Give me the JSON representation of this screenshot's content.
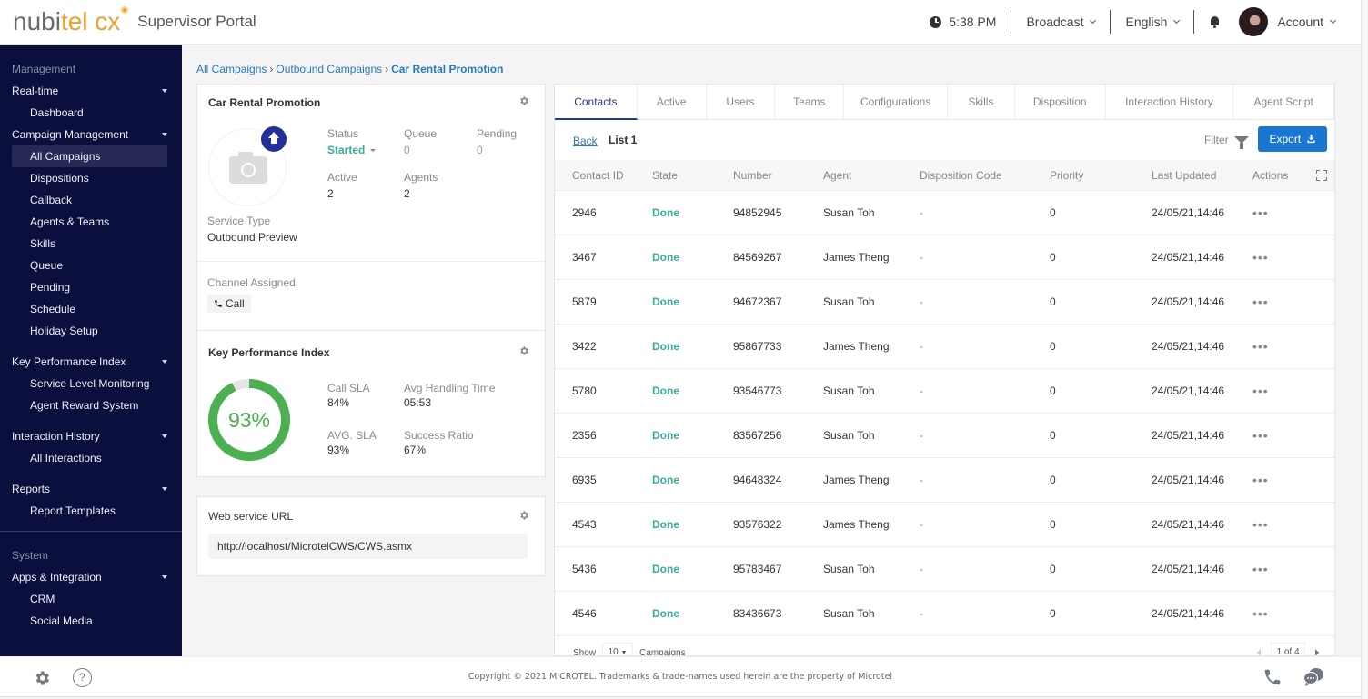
{
  "header": {
    "logo_part1": "nubi",
    "logo_part2": "tel cx",
    "portal_title": "Supervisor Portal",
    "time": "5:38 PM",
    "broadcast_label": "Broadcast",
    "language_label": "English",
    "account_label": "Account"
  },
  "sidebar": {
    "management_label": "Management",
    "groups": [
      {
        "label": "Real-time",
        "items": [
          "Dashboard"
        ]
      },
      {
        "label": "Campaign Management",
        "items": [
          "All Campaigns",
          "Dispositions",
          "Callback",
          "Agents & Teams",
          "Skills",
          "Queue",
          "Pending",
          "Schedule",
          "Holiday Setup"
        ]
      },
      {
        "label": "Key Performance Index",
        "items": [
          "Service Level Monitoring",
          "Agent Reward System"
        ]
      },
      {
        "label": "Interaction History",
        "items": [
          "All Interactions"
        ]
      },
      {
        "label": "Reports",
        "items": [
          "Report Templates"
        ]
      }
    ],
    "system_label": "System",
    "system_groups": [
      {
        "label": "Apps & Integration",
        "items": [
          "CRM",
          "Social Media"
        ]
      }
    ],
    "active_item": "All Campaigns"
  },
  "breadcrumb": {
    "items": [
      "All Campaigns",
      "Outbound Campaigns"
    ],
    "current": "Car Rental Promotion",
    "separator": "›"
  },
  "campaign_card": {
    "title": "Car Rental Promotion",
    "status_label": "Status",
    "status_value": "Started",
    "queue_label": "Queue",
    "queue_value": "0",
    "pending_label": "Pending",
    "pending_value": "0",
    "active_label": "Active",
    "active_value": "2",
    "agents_label": "Agents",
    "agents_value": "2",
    "service_type_label": "Service Type",
    "service_type_value": "Outbound Preview",
    "channel_label": "Channel Assigned",
    "channel_value": "Call"
  },
  "kpi_card": {
    "title": "Key Performance Index",
    "donut_value": "93%",
    "donut_fraction": 0.93,
    "call_sla_label": "Call SLA",
    "call_sla_value": "84%",
    "aht_label": "Avg Handling Time",
    "aht_value": "05:53",
    "avg_sla_label": "AVG. SLA",
    "avg_sla_value": "93%",
    "success_label": "Success Ratio",
    "success_value": "67%",
    "color": "#4caf50"
  },
  "web_service": {
    "title": "Web service URL",
    "url": "http://localhost/MicrotelCWS/CWS.asmx"
  },
  "tabs": [
    {
      "label": "Contacts",
      "active": true
    },
    {
      "label": "Active"
    },
    {
      "label": "Users"
    },
    {
      "label": "Teams"
    },
    {
      "label": "Configurations"
    },
    {
      "label": "Skills"
    },
    {
      "label": "Disposition"
    },
    {
      "label": "Interaction History"
    },
    {
      "label": "Agent Script"
    }
  ],
  "toolbar": {
    "back_label": "Back",
    "list_name": "List 1",
    "filter_label": "Filter",
    "export_label": "Export"
  },
  "table": {
    "columns": [
      "Contact ID",
      "State",
      "Number",
      "Agent",
      "Disposition Code",
      "Priority",
      "Last Updated",
      "Actions"
    ],
    "rows": [
      [
        "2946",
        "Done",
        "94852945",
        "Susan Toh",
        "-",
        "0",
        "24/05/21,14:46"
      ],
      [
        "3467",
        "Done",
        "84569267",
        "James Theng",
        "-",
        "0",
        "24/05/21,14:46"
      ],
      [
        "5879",
        "Done",
        "94672367",
        "Susan Toh",
        "-",
        "0",
        "24/05/21,14:46"
      ],
      [
        "3422",
        "Done",
        "95867733",
        "James Theng",
        "-",
        "0",
        "24/05/21,14:46"
      ],
      [
        "5780",
        "Done",
        "93546773",
        "Susan Toh",
        "-",
        "0",
        "24/05/21,14:46"
      ],
      [
        "2356",
        "Done",
        "83567256",
        "Susan Toh",
        "-",
        "0",
        "24/05/21,14:46"
      ],
      [
        "6935",
        "Done",
        "94648324",
        "James Theng",
        "-",
        "0",
        "24/05/21,14:46"
      ],
      [
        "4543",
        "Done",
        "93576322",
        "James Theng",
        "-",
        "0",
        "24/05/21,14:46"
      ],
      [
        "5436",
        "Done",
        "95783467",
        "Susan Toh",
        "-",
        "0",
        "24/05/21,14:46"
      ],
      [
        "4546",
        "Done",
        "83436673",
        "Susan Toh",
        "-",
        "0",
        "24/05/21,14:46"
      ]
    ],
    "actions_glyph": "•••"
  },
  "pagination": {
    "show_label": "Show",
    "page_size": "10",
    "suffix_label": "Campaigns",
    "page_indicator": "1 of 4"
  },
  "footer": {
    "copyright": "Copyright © 2021 MICROTEL. Trademarks & trade-names used herein are the property of Microtel",
    "help_glyph": "?"
  },
  "colors": {
    "sidebar_bg": "#0a0f3d",
    "accent": "#1976d2",
    "status_done": "#3aaa9a",
    "tab_active": "#2b3a8c"
  }
}
